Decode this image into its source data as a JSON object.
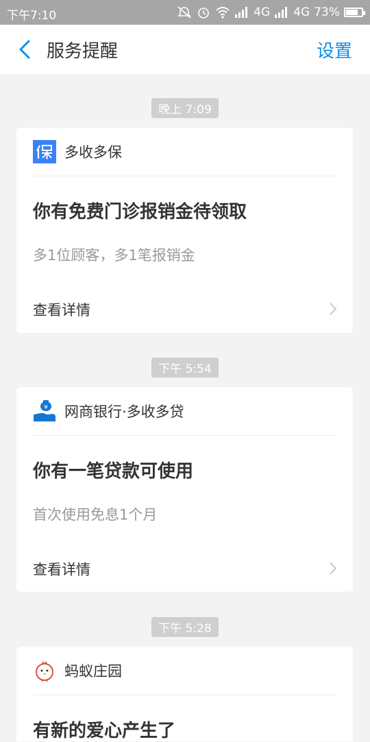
{
  "status_bar": {
    "time": "下午7:10",
    "network1": "4G",
    "network2": "4G",
    "battery": "73%"
  },
  "header": {
    "title": "服务提醒",
    "settings_label": "设置"
  },
  "colors": {
    "accent": "#108ee9",
    "background": "#f3f3f3"
  },
  "messages": [
    {
      "timestamp": "晚上 7:09",
      "source": "多收多保",
      "icon": "insurance-icon",
      "title": "你有免费门诊报销金待领取",
      "description": "多1位顾客，多1笔报销金",
      "link_label": "查看详情"
    },
    {
      "timestamp": "下午 5:54",
      "source": "网商银行·多收多贷",
      "icon": "money-bag-hand-icon",
      "title": "你有一笔贷款可使用",
      "description": "首次使用免息1个月",
      "link_label": "查看详情"
    },
    {
      "timestamp": "下午 5:28",
      "source": "蚂蚁庄园",
      "icon": "chick-icon",
      "title": "有新的爱心产生了"
    }
  ]
}
